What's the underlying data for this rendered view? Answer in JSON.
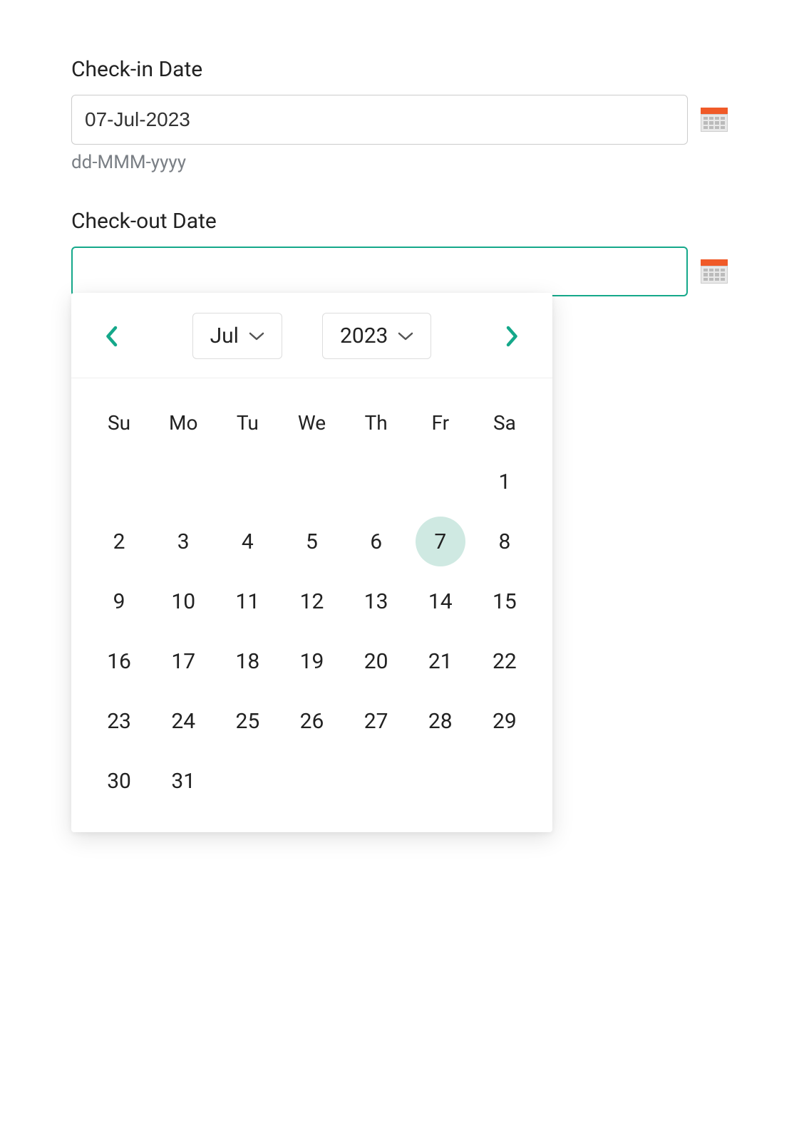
{
  "checkin": {
    "label": "Check-in Date",
    "value": "07-Jul-2023",
    "hint": "dd-MMM-yyyy"
  },
  "checkout": {
    "label": "Check-out Date",
    "value": ""
  },
  "calendar": {
    "month": "Jul",
    "year": "2023",
    "dow": [
      "Su",
      "Mo",
      "Tu",
      "We",
      "Th",
      "Fr",
      "Sa"
    ],
    "weeks": [
      [
        "",
        "",
        "",
        "",
        "",
        "",
        "1"
      ],
      [
        "2",
        "3",
        "4",
        "5",
        "6",
        "7",
        "8"
      ],
      [
        "9",
        "10",
        "11",
        "12",
        "13",
        "14",
        "15"
      ],
      [
        "16",
        "17",
        "18",
        "19",
        "20",
        "21",
        "22"
      ],
      [
        "23",
        "24",
        "25",
        "26",
        "27",
        "28",
        "29"
      ],
      [
        "30",
        "31",
        "",
        "",
        "",
        "",
        ""
      ]
    ],
    "highlighted_day": "7"
  }
}
